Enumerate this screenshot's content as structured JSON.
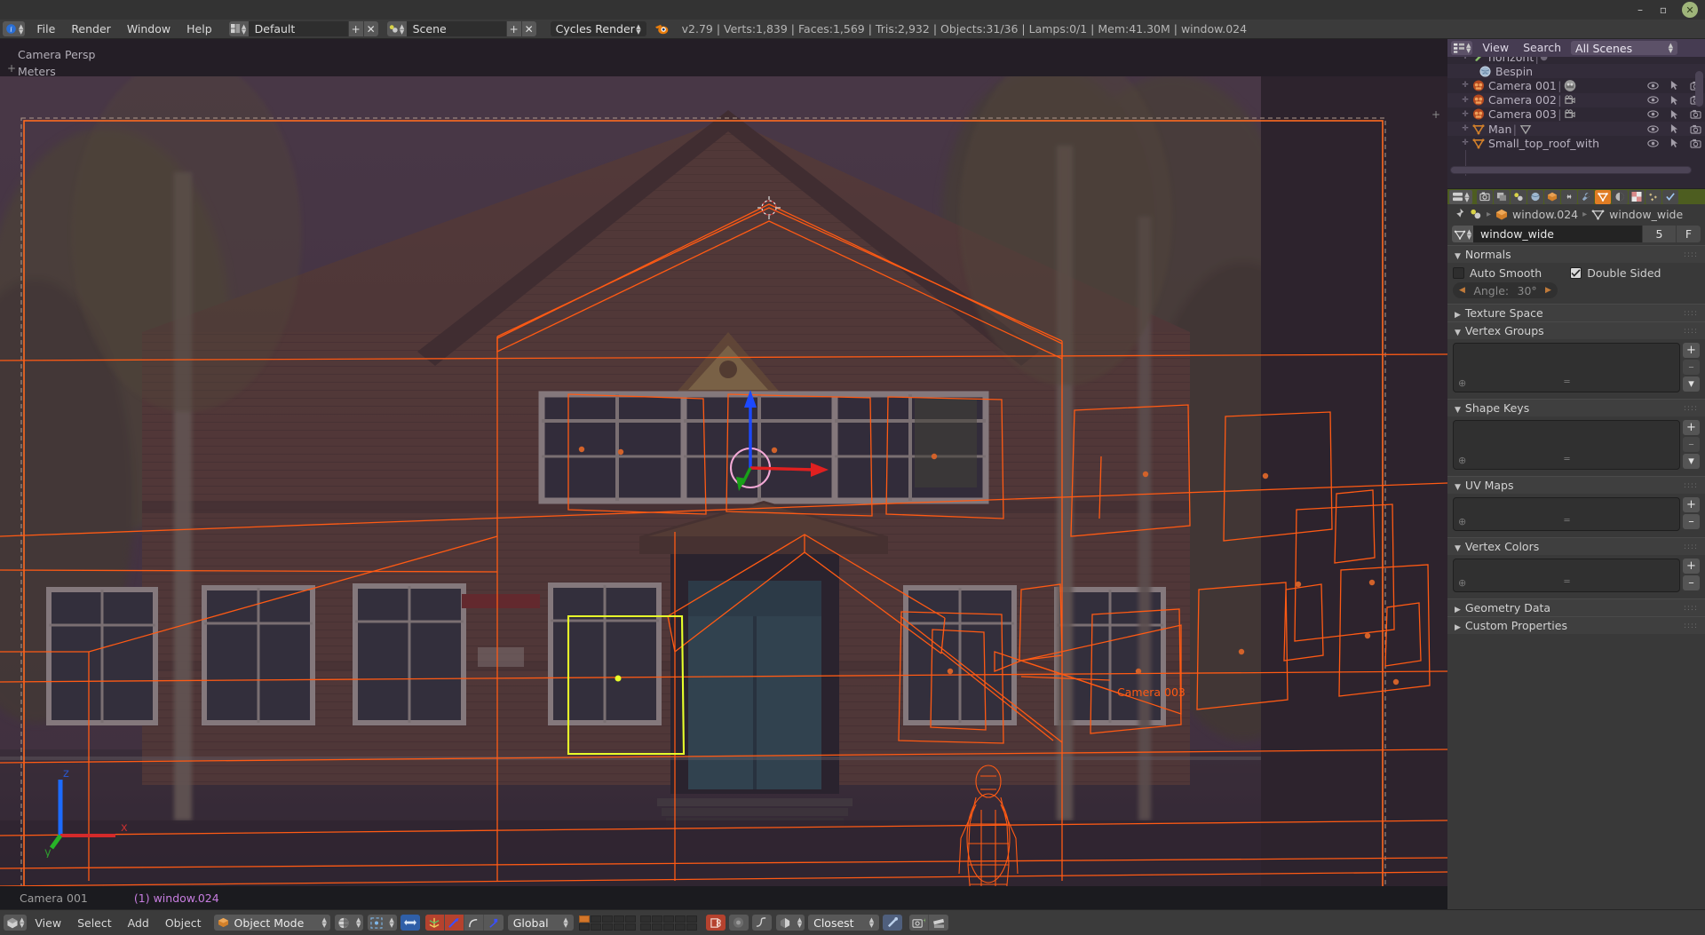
{
  "window": {
    "minimize": "–",
    "maximize": "▫",
    "close": "✕"
  },
  "topbar": {
    "editor_icon": "info-editor-icon",
    "menus": [
      "File",
      "Render",
      "Window",
      "Help"
    ],
    "screen_layout": {
      "name": "Default",
      "add": "+",
      "remove": "✕"
    },
    "scene": {
      "name": "Scene",
      "add": "+",
      "remove": "✕"
    },
    "engine": "Cycles Render",
    "stats": "v2.79 | Verts:1,839 | Faces:1,569 | Tris:2,932 | Objects:31/36 | Lamps:0/1 | Mem:41.30M | window.024"
  },
  "viewport": {
    "view_name": "Camera Persp",
    "units": "Meters",
    "footer_camera": "Camera 001",
    "footer_object": "(1) window.024",
    "camera_label_in_scene": "Camera 003",
    "axis_x": "x",
    "axis_y": "y",
    "axis_z": "z",
    "plus_left": "+",
    "plus_right": "+"
  },
  "outliner": {
    "header": {
      "editor_icon": "outliner-editor-icon",
      "menus": [
        "View",
        "Search"
      ],
      "display_mode": "All Scenes"
    },
    "rows": [
      {
        "label": "horizont",
        "icon": "animation-data-icon",
        "expand": "+",
        "has_sep": true,
        "has_extra_dot": true,
        "eye": false,
        "cursor": false,
        "camera": false
      },
      {
        "label": "Bespin",
        "icon": "world-icon",
        "expand": "",
        "has_sep": false,
        "eye": false,
        "cursor": false,
        "camera": false
      },
      {
        "label": "Camera 001",
        "icon": "camera-object-icon",
        "expand": "+",
        "has_sep": true,
        "data_icon": "camera-data-selected-icon",
        "eye": true,
        "cursor": true,
        "camera": true
      },
      {
        "label": "Camera 002",
        "icon": "camera-object-icon",
        "expand": "+",
        "has_sep": true,
        "data_icon": "camera-data-icon",
        "eye": true,
        "cursor": true,
        "camera": true
      },
      {
        "label": "Camera 003",
        "icon": "camera-object-icon",
        "expand": "+",
        "has_sep": true,
        "data_icon": "camera-data-icon",
        "eye": true,
        "cursor": true,
        "camera": true
      },
      {
        "label": "Man",
        "icon": "mesh-object-icon",
        "expand": "+",
        "has_sep": true,
        "data_icon": "mesh-data-icon",
        "eye": true,
        "cursor": true,
        "camera": true
      },
      {
        "label": "Small_top_roof_without_sn",
        "icon": "mesh-object-icon",
        "expand": "+",
        "has_sep": false,
        "eye": true,
        "cursor": true,
        "camera": true
      }
    ]
  },
  "properties": {
    "tabs": [
      {
        "name": "render-tab",
        "glyph": "camera-back",
        "selected": false
      },
      {
        "name": "render-layers-tab",
        "glyph": "layers",
        "selected": false
      },
      {
        "name": "scene-tab",
        "glyph": "scene",
        "selected": false
      },
      {
        "name": "world-tab",
        "glyph": "world",
        "selected": false
      },
      {
        "name": "object-tab",
        "glyph": "cube",
        "selected": false
      },
      {
        "name": "constraints-tab",
        "glyph": "link",
        "selected": false
      },
      {
        "name": "modifiers-tab",
        "glyph": "wrench",
        "selected": false
      },
      {
        "name": "object-data-tab",
        "glyph": "mesh-data",
        "selected": true
      },
      {
        "name": "material-tab",
        "glyph": "material",
        "selected": false
      },
      {
        "name": "texture-tab",
        "glyph": "checker",
        "selected": false
      },
      {
        "name": "particles-tab",
        "glyph": "particles",
        "selected": false
      },
      {
        "name": "physics-tab",
        "glyph": "physics",
        "selected": false
      }
    ],
    "breadcrumb": {
      "pin": "pin-icon",
      "scene_icon": "scene-icon",
      "object": "window.024",
      "data": "window_wide",
      "arrow": "▸"
    },
    "name_field": {
      "value": "window_wide",
      "users": "5",
      "fake_user": "F"
    },
    "panels": [
      {
        "title": "Normals",
        "open": true
      },
      {
        "title": "Texture Space",
        "open": false
      },
      {
        "title": "Vertex Groups",
        "open": true
      },
      {
        "title": "Shape Keys",
        "open": true
      },
      {
        "title": "UV Maps",
        "open": true
      },
      {
        "title": "Vertex Colors",
        "open": true
      },
      {
        "title": "Geometry Data",
        "open": false
      },
      {
        "title": "Custom Properties",
        "open": false
      }
    ],
    "normals": {
      "auto_smooth_label": "Auto Smooth",
      "auto_smooth_checked": false,
      "double_sided_label": "Double Sided",
      "double_sided_checked": true,
      "angle_label": "Angle:",
      "angle_value": "30°"
    },
    "list_buttons": {
      "add": "+",
      "remove": "–",
      "menu": "▾"
    }
  },
  "bottombar": {
    "editor_icon": "view3d-editor-icon",
    "menus": [
      "View",
      "Select",
      "Add",
      "Object"
    ],
    "mode": "Object Mode",
    "transform_orientation": "Global",
    "snap_target": "Closest",
    "icons": {
      "mode_icon": "object-mode-cube-icon",
      "shading_icon": "solid-shading-icon",
      "pivot_icon": "pivot-median-icon",
      "manipulator_translate": "translate-manipulator-icon",
      "manipulator_rotate": "rotate-manipulator-icon",
      "manipulator_scale": "scale-manipulator-icon",
      "snap_magnet": "snap-magnet-icon",
      "proportional": "proportional-edit-icon",
      "render_active": "render-active-icon",
      "camera_add": "add-camera-icon",
      "render_animation": "render-animation-icon"
    },
    "layers": {
      "top": [
        true,
        false,
        false,
        false,
        false,
        false,
        false,
        false,
        false,
        false
      ],
      "bottom": [
        false,
        false,
        false,
        false,
        false,
        false,
        false,
        false,
        false,
        false
      ]
    }
  },
  "colors": {
    "accent_orange": "#e07c24",
    "selection_orange": "#ff5a14",
    "active_yellow": "#e8ff2a",
    "outliner_purple": "#463c52",
    "props_tab_green": "#4d5d20",
    "object_name_purple": "#c77de0"
  }
}
